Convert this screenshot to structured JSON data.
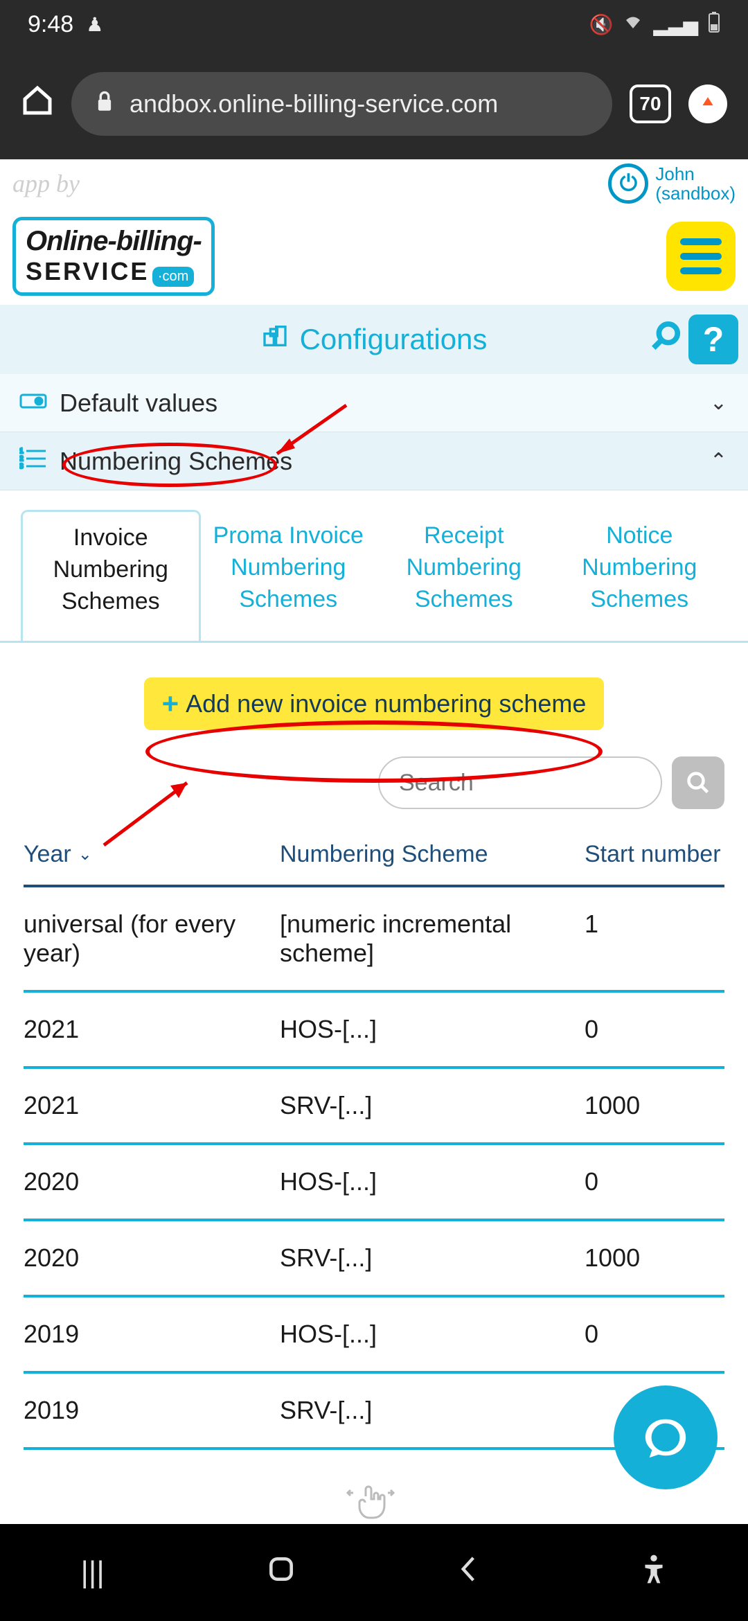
{
  "status_bar": {
    "time": "9:48",
    "icons": [
      "mute",
      "wifi",
      "signal",
      "battery"
    ]
  },
  "browser": {
    "url": "andbox.online-billing-service.com",
    "tab_count": "70"
  },
  "app_header": {
    "tagline": "app by",
    "user_name": "John",
    "user_mode": "(sandbox)"
  },
  "logo": {
    "line1": "Online-billing-",
    "line2": "SERVICE",
    "badge": "·com"
  },
  "config_bar": {
    "title": "Configurations"
  },
  "sections": {
    "default_values": "Default values",
    "numbering_schemes": "Numbering Schemes"
  },
  "tabs": [
    {
      "label": "Invoice Numbering Schemes",
      "active": true
    },
    {
      "label": "Proma Invoice Numbering Schemes",
      "active": false
    },
    {
      "label": "Receipt Numbering Schemes",
      "active": false
    },
    {
      "label": "Notice Numbering Schemes",
      "active": false
    }
  ],
  "add_button": "Add new invoice numbering scheme",
  "search_placeholder": "Search",
  "table": {
    "headers": {
      "year": "Year",
      "scheme": "Numbering Scheme",
      "start": "Start number"
    },
    "rows": [
      {
        "year": "universal (for every year)",
        "scheme": "[numeric incremental scheme]",
        "start": "1"
      },
      {
        "year": "2021",
        "scheme": "HOS-[...]",
        "start": "0"
      },
      {
        "year": "2021",
        "scheme": "SRV-[...]",
        "start": "1000"
      },
      {
        "year": "2020",
        "scheme": "HOS-[...]",
        "start": "0"
      },
      {
        "year": "2020",
        "scheme": "SRV-[...]",
        "start": "1000"
      },
      {
        "year": "2019",
        "scheme": "HOS-[...]",
        "start": "0"
      },
      {
        "year": "2019",
        "scheme": "SRV-[...]",
        "start": ""
      }
    ]
  }
}
